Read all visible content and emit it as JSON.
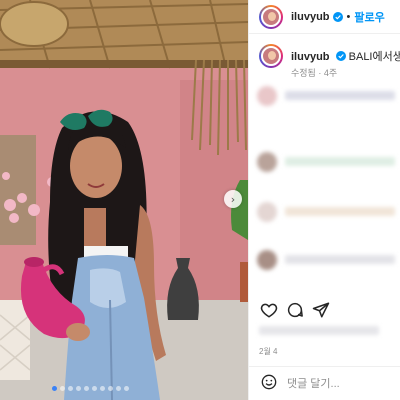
{
  "post": {
    "username": "iluvyub",
    "separator": "•",
    "follow_label": "팔로우",
    "caption_text": "BALI에서생긴일",
    "caption_meta": "수정됨 · 4주",
    "date": "2월 4",
    "comment_placeholder": "댓글 달기...",
    "carousel": {
      "slide_count": 10,
      "current_slide": 1
    }
  },
  "colors": {
    "accent": "#0095f6",
    "verified": "#0095f6",
    "wall": "#d98f92",
    "dress": "#8fb0d6",
    "vase": "#d6337a"
  },
  "icons": {
    "verified": "verified-badge-icon",
    "like": "heart-icon",
    "comment": "comment-bubble-icon",
    "share": "paper-plane-icon",
    "emoji": "smiley-icon",
    "next": "chevron-right-icon"
  }
}
